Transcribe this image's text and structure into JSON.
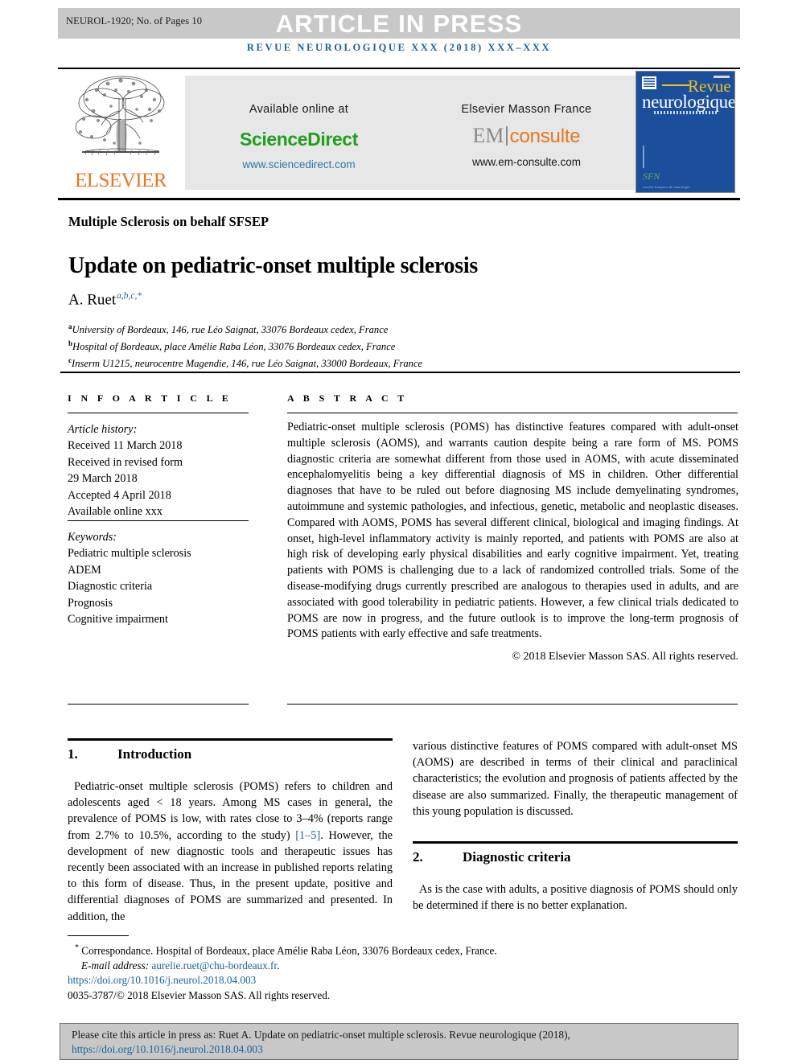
{
  "banner": {
    "article_id": "NEUROL-1920; No. of Pages 10",
    "press_label": "ARTICLE IN PRESS"
  },
  "running_head": "REVUE NEUROLOGIQUE XXX (2018) XXX–XXX",
  "masthead": {
    "publisher_word": "ELSEVIER",
    "available_online_label": "Available online at",
    "sciencedirect_brand": "ScienceDirect",
    "sciencedirect_url": "www.sciencedirect.com",
    "em_masson_label": "Elsevier Masson France",
    "em_brand_left": "EM",
    "em_brand_right": "consulte",
    "em_url": "www.em-consulte.com",
    "cover": {
      "revue": "Revue",
      "neurologique": "neurologique",
      "society_logo": "SFN"
    }
  },
  "article": {
    "subject_line": "Multiple Sclerosis on behalf SFSEP",
    "title": "Update on pediatric-onset multiple sclerosis",
    "author_name": "A. Ruet",
    "author_affil_marks": "a,b,c,*",
    "affiliations": [
      {
        "mark": "a",
        "text": "University of Bordeaux, 146, rue Léo Saignat, 33076 Bordeaux cedex, France"
      },
      {
        "mark": "b",
        "text": "Hospital of Bordeaux, place Amélie Raba Léon, 33076 Bordeaux cedex, France"
      },
      {
        "mark": "c",
        "text": "Inserm U1215, neurocentre Magendie, 146, rue Léo Saignat, 33000 Bordeaux, France"
      }
    ]
  },
  "info_article": {
    "section_label": "I N F O   A R T I C L E",
    "history_label": "Article history:",
    "history": [
      "Received 11 March 2018",
      "Received in revised form",
      "29 March 2018",
      "Accepted 4 April 2018",
      "Available online xxx"
    ],
    "keywords_label": "Keywords:",
    "keywords": [
      "Pediatric multiple sclerosis",
      "ADEM",
      "Diagnostic criteria",
      "Prognosis",
      "Cognitive impairment"
    ]
  },
  "abstract": {
    "section_label": "A B S T R A C T",
    "body": "Pediatric-onset multiple sclerosis (POMS) has distinctive features compared with adult-onset multiple sclerosis (AOMS), and warrants caution despite being a rare form of MS. POMS diagnostic criteria are somewhat different from those used in AOMS, with acute disseminated encephalomyelitis being a key differential diagnosis of MS in children. Other differential diagnoses that have to be ruled out before diagnosing MS include demyelinating syndromes, autoimmune and systemic pathologies, and infectious, genetic, metabolic and neoplastic diseases. Compared with AOMS, POMS has several different clinical, biological and imaging findings. At onset, high-level inflammatory activity is mainly reported, and patients with POMS are also at high risk of developing early physical disabilities and early cognitive impairment. Yet, treating patients with POMS is challenging due to a lack of randomized controlled trials. Some of the disease-modifying drugs currently prescribed are analogous to therapies used in adults, and are associated with good tolerability in pediatric patients. However, a few clinical trials dedicated to POMS are now in progress, and the future outlook is to improve the long-term prognosis of POMS patients with early effective and safe treatments.",
    "copyright": "© 2018 Elsevier Masson SAS. All rights reserved."
  },
  "body": {
    "section1_number": "1.",
    "section1_title": "Introduction",
    "section1_p1_a": "Pediatric-onset multiple sclerosis (POMS) refers to children and adolescents aged < 18 years. Among MS cases in general, the prevalence of POMS is low, with rates close to 3–4% (reports range from 2.7% to 10.5%, according to the study) ",
    "section1_ref": "[1–5]",
    "section1_p1_b": ". However, the development of new diagnostic tools and therapeutic issues has recently been associated with an increase in published reports relating to this form of disease. Thus, in the present update, positive and differential diagnoses of POMS are summarized and presented. In addition, the",
    "section1_cont": "various distinctive features of POMS compared with adult-onset MS (AOMS) are described in terms of their clinical and paraclinical characteristics; the evolution and prognosis of patients affected by the disease are also summarized. Finally, the therapeutic management of this young population is discussed.",
    "section2_number": "2.",
    "section2_title": "Diagnostic criteria",
    "section2_p1": "As is the case with adults, a positive diagnosis of POMS should only be determined if there is no better explanation."
  },
  "footnotes": {
    "correspondence_mark": "*",
    "correspondence": "Correspondance. Hospital of Bordeaux, place Amélie Raba Léon, 33076 Bordeaux cedex, France.",
    "email_label": "E-mail address:",
    "email": "aurelie.ruet@chu-bordeaux.fr",
    "email_trail": ".",
    "doi": "https://doi.org/10.1016/j.neurol.2018.04.003",
    "issn_line": "0035-3787/© 2018 Elsevier Masson SAS. All rights reserved."
  },
  "cite_box": {
    "text": "Please cite this article in press as: Ruet A. Update on pediatric-onset multiple sclerosis. Revue neurologique (2018), ",
    "link": "https://doi.org/10.1016/j.neurol.2018.04.003"
  },
  "colors": {
    "link_blue": "#1a6496",
    "banner_gray": "#c8c8c8",
    "elsevier_orange": "#e87722",
    "sciencedirect_green": "#1f9e1f",
    "em_orange": "#e8761a",
    "cover_blue": "#1b4f9c"
  }
}
